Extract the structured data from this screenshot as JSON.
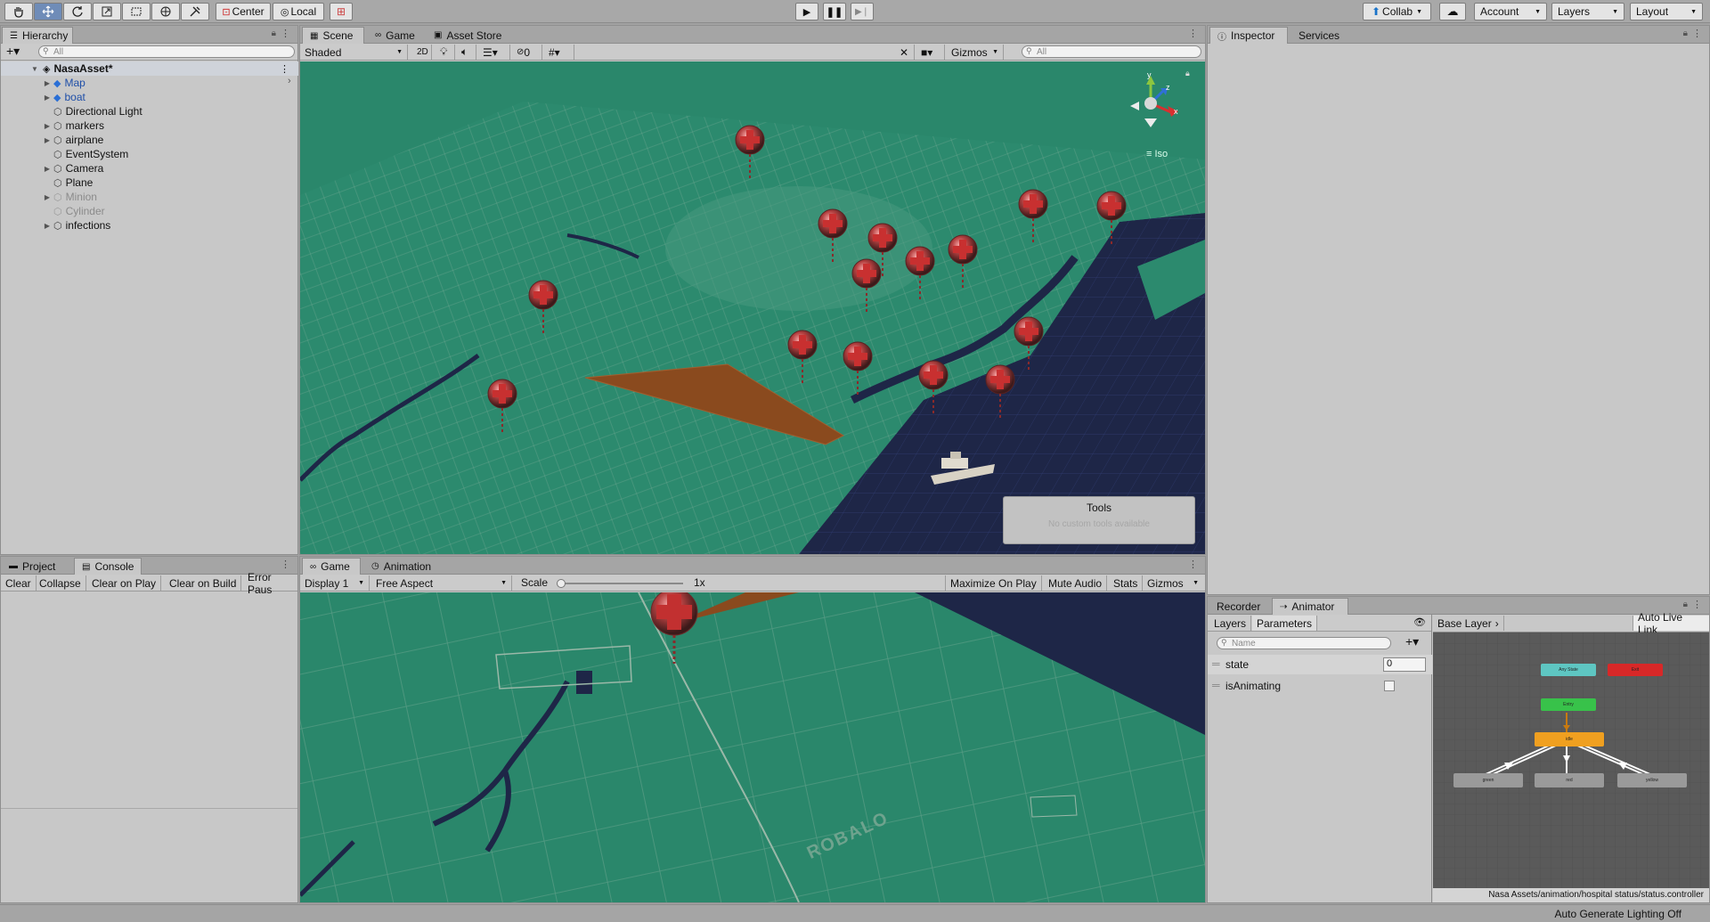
{
  "toolbar": {
    "tools": [
      "hand-tool-icon",
      "move-tool-icon",
      "rotate-tool-icon",
      "scale-tool-icon",
      "rect-tool-icon",
      "transform-tool-icon",
      "custom-tool-icon"
    ],
    "pivot_label": "Center",
    "space_label": "Local",
    "collab_label": "Collab",
    "account_label": "Account",
    "layers_label": "Layers",
    "layout_label": "Layout"
  },
  "hierarchy": {
    "tab_label": "Hierarchy",
    "search_placeholder": "All",
    "scene_name": "NasaAsset*",
    "items": [
      {
        "label": "Map",
        "style": "blue",
        "expandable": true
      },
      {
        "label": "boat",
        "style": "blue",
        "expandable": true
      },
      {
        "label": "Directional Light",
        "style": "normal",
        "expandable": false
      },
      {
        "label": "markers",
        "style": "normal",
        "expandable": true
      },
      {
        "label": "airplane",
        "style": "normal",
        "expandable": true
      },
      {
        "label": "EventSystem",
        "style": "normal",
        "expandable": false
      },
      {
        "label": "Camera",
        "style": "normal",
        "expandable": true
      },
      {
        "label": "Plane",
        "style": "normal",
        "expandable": false
      },
      {
        "label": "Minion",
        "style": "dim",
        "expandable": true
      },
      {
        "label": "Cylinder",
        "style": "dim",
        "expandable": false
      },
      {
        "label": "infections",
        "style": "normal",
        "expandable": true
      }
    ]
  },
  "scene": {
    "tabs": [
      "Scene",
      "Game",
      "Asset Store"
    ],
    "shading_mode": "Shaded",
    "mode_2d": "2D",
    "hidden_count": "0",
    "gizmos_label": "Gizmos",
    "search_placeholder": "All",
    "projection_label": "Iso",
    "tools_overlay_title": "Tools",
    "tools_overlay_text": "No custom tools available"
  },
  "project_console": {
    "tabs": [
      "Project",
      "Console"
    ],
    "buttons": [
      "Clear",
      "Collapse",
      "Clear on Play",
      "Clear on Build",
      "Error Paus"
    ]
  },
  "game": {
    "tabs": [
      "Game",
      "Animation"
    ],
    "display": "Display 1",
    "aspect": "Free Aspect",
    "scale_label": "Scale",
    "scale_value": "1x",
    "buttons": [
      "Maximize On Play",
      "Mute Audio",
      "Stats",
      "Gizmos"
    ],
    "map_label": "ROBALO"
  },
  "inspector": {
    "tabs": [
      "Inspector",
      "Services"
    ]
  },
  "animator": {
    "tabs": [
      "Recorder",
      "Animator"
    ],
    "subtabs": [
      "Layers",
      "Parameters"
    ],
    "name_placeholder": "Name",
    "layer_name": "Base Layer",
    "auto_live_link": "Auto Live Link",
    "parameters": [
      {
        "name": "state",
        "value": "0"
      },
      {
        "name": "isAnimating",
        "value": ""
      }
    ],
    "states": {
      "any_state": "Any State",
      "exit": "Exit",
      "entry": "Entry",
      "idle": "idle",
      "green": "green",
      "red": "red",
      "yellow": "yellow"
    },
    "footer_path": "Nasa Assets/animation/hospital status/status.controller"
  },
  "status": {
    "lighting": "Auto Generate Lighting Off"
  },
  "colors": {
    "map_green": "#2d8a6f",
    "water": "#1f2a4a",
    "airport": "#8a4a1e",
    "state_orange": "#f0a020",
    "state_green": "#38c24a",
    "state_red": "#d82828",
    "state_cyan": "#5ec6c2"
  }
}
